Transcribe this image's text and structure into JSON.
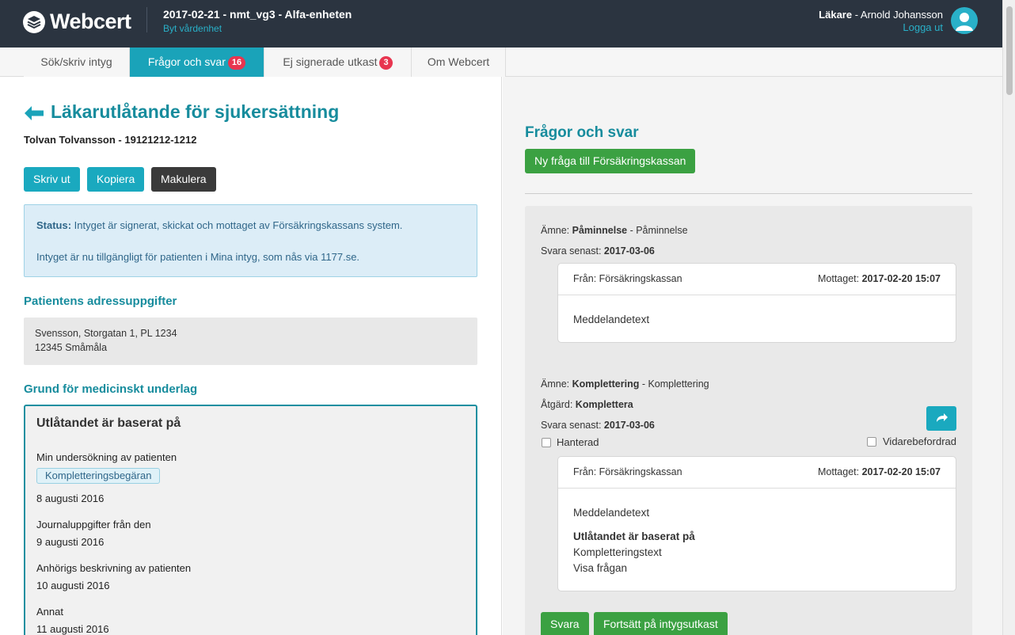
{
  "header": {
    "logo_text": "Webcert",
    "title": "2017-02-21 - nmt_vg3 - Alfa-enheten",
    "change_unit": "Byt vårdenhet",
    "user_role": "Läkare",
    "user_name": " - Arnold Johansson",
    "logout": "Logga ut"
  },
  "tabs": [
    {
      "label": "Sök/skriv intyg",
      "badge": null,
      "active": false
    },
    {
      "label": "Frågor och svar",
      "badge": "16",
      "active": true
    },
    {
      "label": "Ej signerade utkast",
      "badge": "3",
      "active": false
    },
    {
      "label": "Om Webcert",
      "badge": null,
      "active": false
    }
  ],
  "certificate": {
    "title": "Läkarutlåtande för sjukersättning",
    "patient": "Tolvan Tolvansson - 19121212-1212",
    "buttons": {
      "print": "Skriv ut",
      "copy": "Kopiera",
      "revoke": "Makulera"
    },
    "status_label": "Status:",
    "status_text": " Intyget är signerat, skickat och mottaget av Försäkringskassans system.",
    "status_text2": "Intyget är nu tillgängligt för patienten i Mina intyg, som nås via 1177.se.",
    "address_heading": "Patientens adressuppgifter",
    "address_line1": "Svensson, Storgatan 1, PL 1234",
    "address_line2": "12345 Småmåla",
    "ground_heading": "Grund för medicinskt underlag",
    "ground_box_title": "Utlåtandet är baserat på",
    "ground_items": [
      {
        "label": "Min undersökning av patienten",
        "tag": "Kompletteringsbegäran",
        "date": "8 augusti 2016"
      },
      {
        "label": "Journaluppgifter från den",
        "date": "9 augusti 2016"
      },
      {
        "label": "Anhörigs beskrivning av patienten",
        "date": "10 augusti 2016"
      },
      {
        "label": "Annat",
        "date": "11 augusti 2016"
      }
    ]
  },
  "qa": {
    "title": "Frågor och svar",
    "new_question_button": "Ny fråga till Försäkringskassan",
    "items": [
      {
        "subject_label": "Ämne:",
        "subject_bold": "Påminnelse",
        "subject_rest": " - Påminnelse",
        "deadline_label": "Svara senast:",
        "deadline": "2017-03-06",
        "from": "Från: Försäkringskassan",
        "received_label": "Mottaget:",
        "received": "2017-02-20 15:07",
        "message": "Meddelandetext"
      },
      {
        "subject_label": "Ämne:",
        "subject_bold": "Komplettering",
        "subject_rest": " - Komplettering",
        "action_label": "Åtgärd:",
        "action": "Komplettera",
        "deadline_label": "Svara senast:",
        "deadline": "2017-03-06",
        "handled_label": "Hanterad",
        "forwarded_label": "Vidarebefordrad",
        "from": "Från: Försäkringskassan",
        "received_label": "Mottaget:",
        "received": "2017-02-20 15:07",
        "message": "Meddelandetext",
        "complement_heading": "Utlåtandet är baserat på",
        "complement_text": "Kompletteringstext",
        "show_question": "Visa frågan",
        "answer_button": "Svara",
        "continue_button": "Fortsätt på intygsutkast"
      }
    ]
  },
  "colors": {
    "header_bg": "#2b3440",
    "accent_teal": "#1aa3b9",
    "heading_teal": "#178c9d",
    "badge_red": "#e8354f",
    "button_green": "#3ba142"
  }
}
